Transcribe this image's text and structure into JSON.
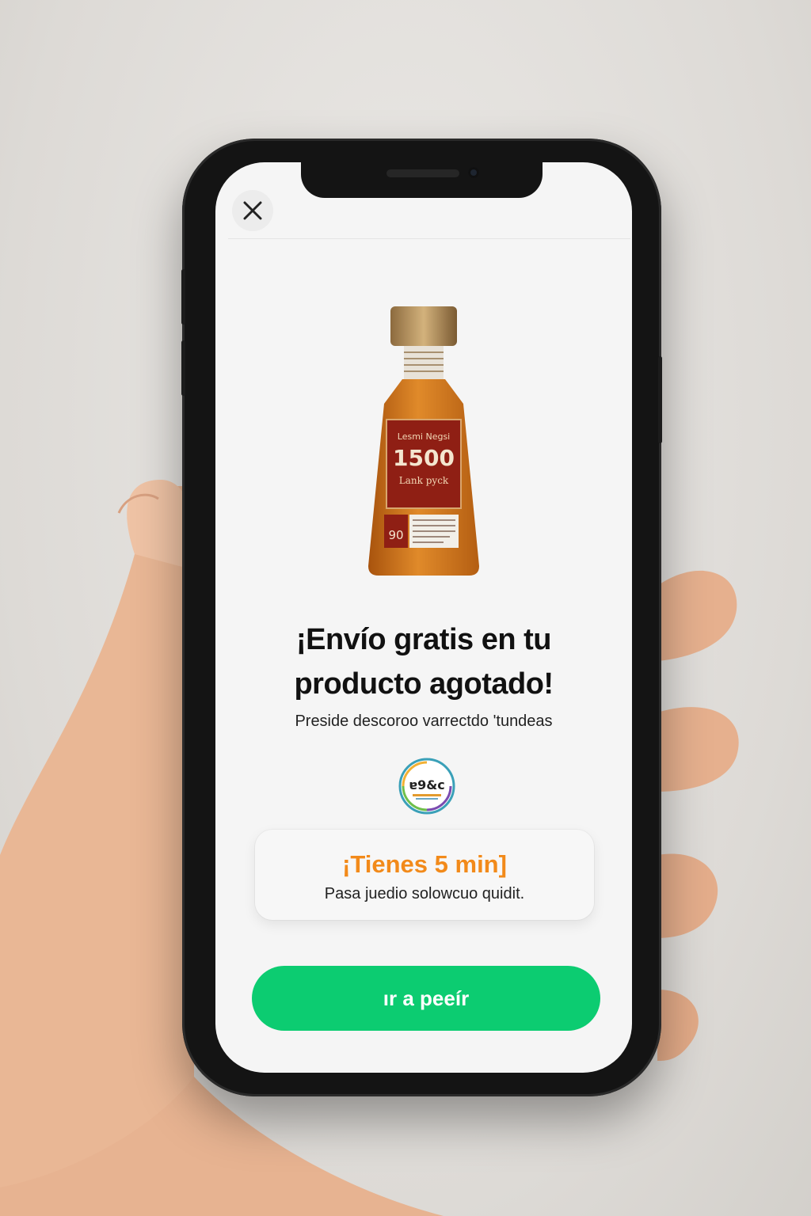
{
  "modal": {
    "close_icon": "close-icon",
    "headline_line1": "¡Envío gratis en tu",
    "headline_line2": "producto agotado!",
    "subtitle": "Preside descoroo varrectdo  'tundeas",
    "timer_title": "¡Tienes 5 min]",
    "timer_subtitle": "Pasa juedio solowcuo quidit.",
    "cta_label": "ır a peeír"
  },
  "product": {
    "label_top": "Lesmi Negsi",
    "label_number": "1500",
    "label_sub": "Lank pyck",
    "badge_number": "90"
  },
  "colors": {
    "accent_green": "#0ccc71",
    "timer_orange": "#f28a1a",
    "screen_bg": "#f5f5f5"
  }
}
